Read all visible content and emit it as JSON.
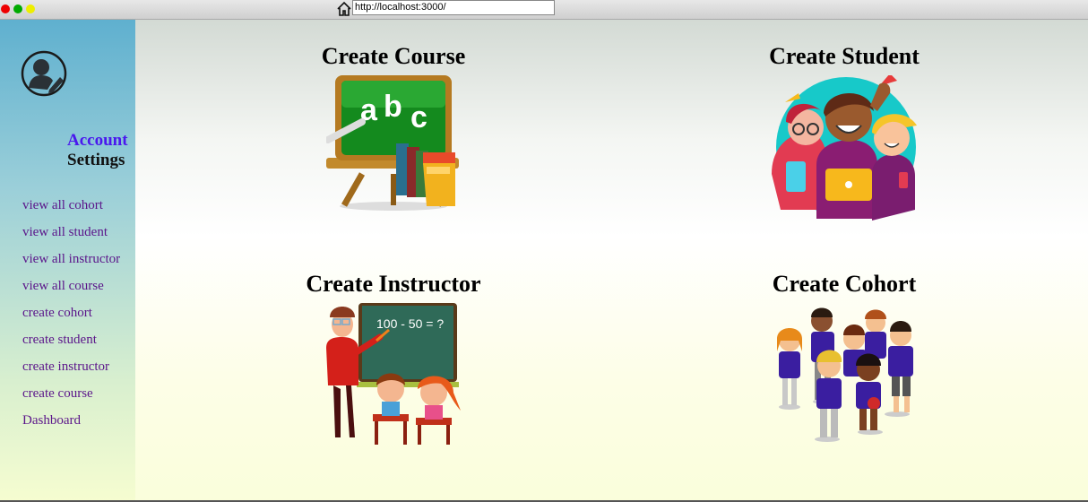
{
  "browser": {
    "url": "http://localhost:3000/"
  },
  "sidebar": {
    "account_title": "Account",
    "account_subtitle": "Settings",
    "items": [
      {
        "label": "view all cohort"
      },
      {
        "label": "view all student"
      },
      {
        "label": "view all instructor"
      },
      {
        "label": "view all course"
      },
      {
        "label": "create cohort"
      },
      {
        "label": "create student"
      },
      {
        "label": "create instructor"
      },
      {
        "label": "create course"
      },
      {
        "label": "Dashboard"
      }
    ]
  },
  "cards": [
    {
      "title": "Create Course",
      "icon": "chalkboard-abc-icon"
    },
    {
      "title": "Create Student",
      "icon": "students-group-icon"
    },
    {
      "title": "Create Instructor",
      "icon": "teacher-classroom-icon"
    },
    {
      "title": "Create Cohort",
      "icon": "cohort-kids-icon"
    }
  ],
  "illustration_text": {
    "chalk_letters": [
      "a",
      "b",
      "c"
    ],
    "math_problem": "100 - 50 = ?"
  },
  "colors": {
    "account_title": "#4a18ee",
    "nav_link": "#5b158a"
  }
}
